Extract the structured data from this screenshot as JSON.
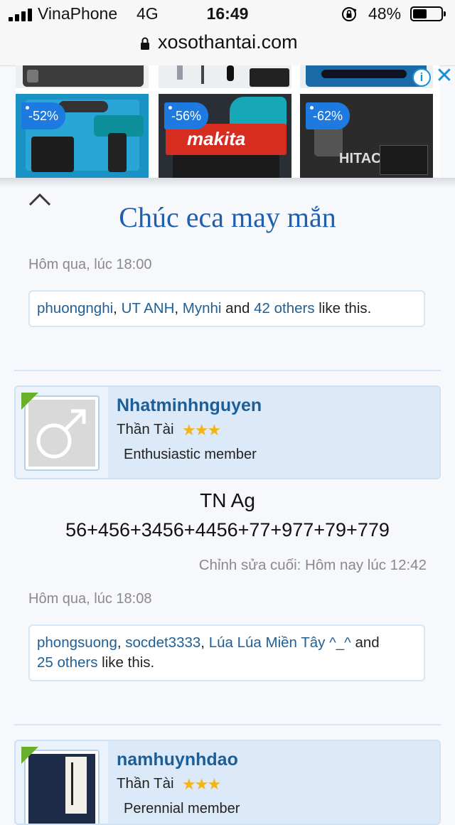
{
  "status_bar": {
    "carrier": "VinaPhone",
    "network": "4G",
    "time": "16:49",
    "battery_percent": "48%",
    "battery_level": 0.48
  },
  "browser": {
    "url": "xosothantai.com"
  },
  "ad": {
    "tiles": [
      {
        "discount": "-52%",
        "bg": "#1a93c4"
      },
      {
        "discount": "-56%",
        "bg": "#2a2f36",
        "brand": "makita"
      },
      {
        "discount": "-62%",
        "bg": "#3a3a3a",
        "brand": "HITAC"
      }
    ],
    "info_icon": "i",
    "close_icon": "✕"
  },
  "posts": [
    {
      "text": "Chúc eca may mắn",
      "date": "Hôm qua, lúc 18:00",
      "likes": {
        "users": [
          "phuongnghi",
          "UT ANH",
          "Mynhi"
        ],
        "sep": ", ",
        "and": " and ",
        "others": "42 others",
        "suffix": " like this."
      }
    },
    {
      "author": {
        "name": "Nhatminhnguyen",
        "title": "Thần Tài",
        "stars": "★★★",
        "rank": "Enthusiastic member"
      },
      "lines": [
        "TN Ag",
        "56+456+3456+4456+77+977+79+779"
      ],
      "edited": "Chỉnh sửa cuối: Hôm nay lúc 12:42",
      "date": "Hôm qua, lúc 18:08",
      "likes": {
        "users": [
          "phongsuong",
          "socdet3333",
          "Lúa Lúa Miền Tây ^_^"
        ],
        "sep": ", ",
        "and": " and",
        "others": "25 others",
        "suffix": " like this."
      }
    },
    {
      "author": {
        "name": "namhuynhdao",
        "title": "Thần Tài",
        "stars": "★★★",
        "rank": "Perennial member"
      }
    }
  ],
  "colors": {
    "link": "#1f5f96",
    "accent": "#1f5fae",
    "online": "#6ab02a",
    "star": "#f2b418"
  }
}
